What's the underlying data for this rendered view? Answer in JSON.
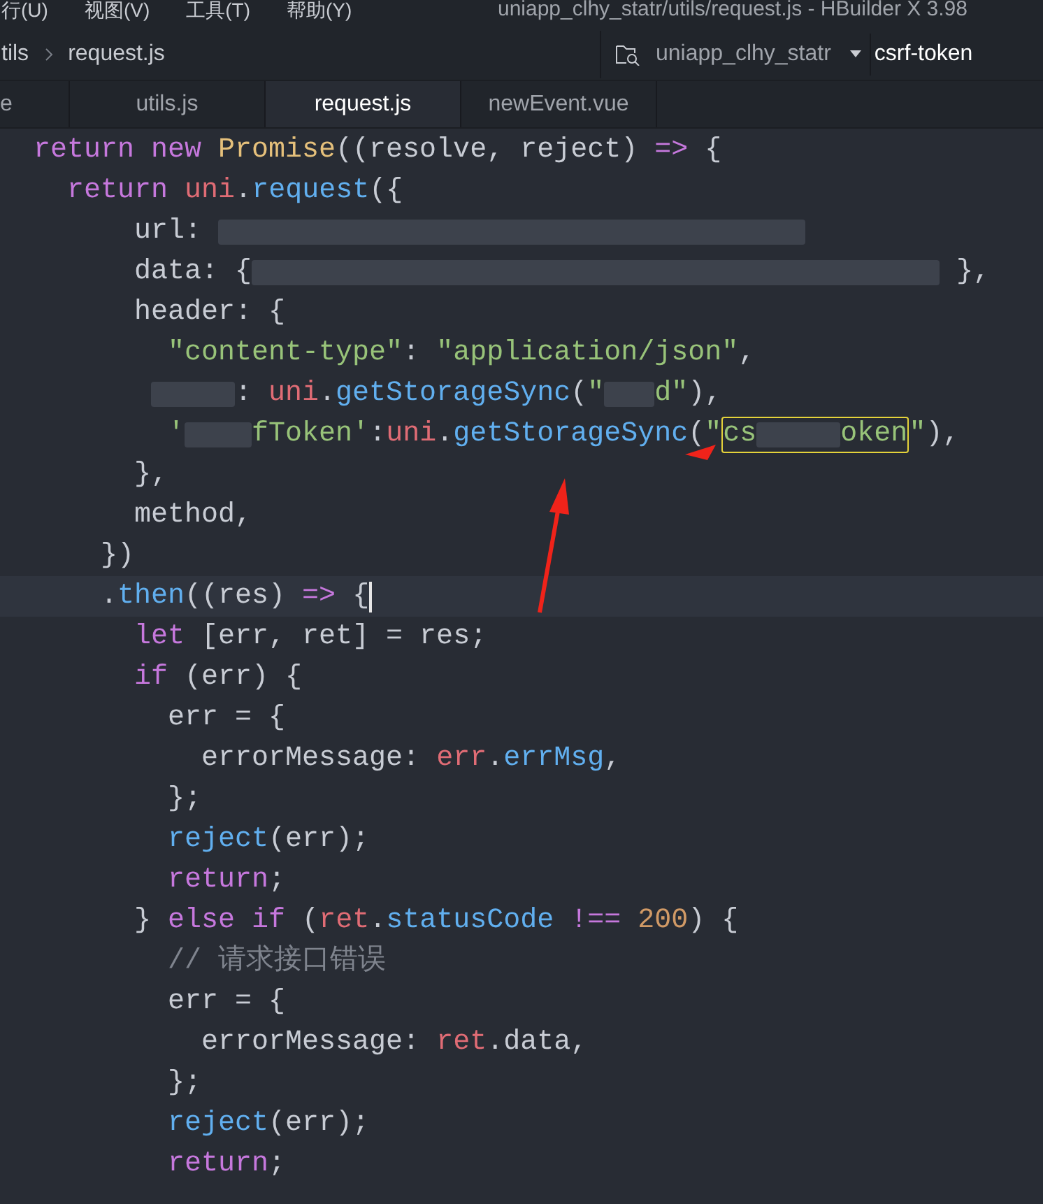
{
  "menu": [
    "行(U)",
    "视图(V)",
    "工具(T)",
    "帮助(Y)"
  ],
  "window": {
    "title": "uniapp_clhy_statr/utils/request.js - HBuilder X 3.98"
  },
  "breadcrumb": [
    "tils",
    "request.js"
  ],
  "project": {
    "name": "uniapp_clhy_statr"
  },
  "search": {
    "value": "csrf-token"
  },
  "tabs": [
    {
      "label": "e",
      "selected": false
    },
    {
      "label": "utils.js",
      "selected": false
    },
    {
      "label": "request.js",
      "selected": true
    },
    {
      "label": "newEvent.vue",
      "selected": false
    }
  ],
  "code": [
    {
      "current": false,
      "tokens": [
        {
          "kind": "kw",
          "text": "  return new "
        },
        {
          "kind": "cls",
          "text": "Promise"
        },
        {
          "kind": "plain",
          "text": "((resolve, reject) "
        },
        {
          "kind": "kw",
          "text": "=>"
        },
        {
          "kind": "plain",
          "text": " {"
        }
      ]
    },
    {
      "current": false,
      "tokens": [
        {
          "kind": "kw",
          "text": "    return "
        },
        {
          "kind": "var",
          "text": "uni"
        },
        {
          "kind": "plain",
          "text": "."
        },
        {
          "kind": "fn",
          "text": "request"
        },
        {
          "kind": "plain",
          "text": "({"
        }
      ]
    },
    {
      "current": false,
      "tokens": [
        {
          "kind": "plain",
          "text": "        url: "
        },
        {
          "kind": "blur_xl"
        }
      ]
    },
    {
      "current": false,
      "tokens": [
        {
          "kind": "plain",
          "text": "        data: {"
        },
        {
          "kind": "blur_xxl"
        },
        {
          "kind": "plain",
          "text": " },"
        }
      ]
    },
    {
      "current": false,
      "tokens": [
        {
          "kind": "plain",
          "text": "        header: {"
        }
      ]
    },
    {
      "current": false,
      "tokens": [
        {
          "kind": "str",
          "text": "          \"content-type\""
        },
        {
          "kind": "plain",
          "text": ": "
        },
        {
          "kind": "str",
          "text": "\"application/json\""
        },
        {
          "kind": "plain",
          "text": ","
        }
      ]
    },
    {
      "current": false,
      "tokens": [
        {
          "kind": "blur_key"
        },
        {
          "kind": "plain",
          "text": ": "
        },
        {
          "kind": "var",
          "text": "uni"
        },
        {
          "kind": "plain",
          "text": "."
        },
        {
          "kind": "fn",
          "text": "getStorageSync"
        },
        {
          "kind": "plain",
          "text": "("
        },
        {
          "kind": "str",
          "text": "\""
        },
        {
          "kind": "blur_s"
        },
        {
          "kind": "str",
          "text": "d\""
        },
        {
          "kind": "plain",
          "text": "),"
        }
      ]
    },
    {
      "current": false,
      "tokens": [
        {
          "kind": "str",
          "text": "          '"
        },
        {
          "kind": "blur_m"
        },
        {
          "kind": "str",
          "text": "fToken'"
        },
        {
          "kind": "plain",
          "text": ":"
        },
        {
          "kind": "var",
          "text": "uni"
        },
        {
          "kind": "plain",
          "text": "."
        },
        {
          "kind": "fn",
          "text": "getStorageSync"
        },
        {
          "kind": "plain",
          "text": "("
        },
        {
          "kind": "str",
          "text": "\""
        },
        {
          "kind": "boxed",
          "tokens": [
            {
              "kind": "str",
              "text": "cs"
            },
            {
              "kind": "blur_l"
            },
            {
              "kind": "str",
              "text": "oken"
            }
          ]
        },
        {
          "kind": "str",
          "text": "\""
        },
        {
          "kind": "plain",
          "text": "),"
        }
      ]
    },
    {
      "current": false,
      "tokens": [
        {
          "kind": "plain",
          "text": "        },"
        }
      ]
    },
    {
      "current": false,
      "tokens": [
        {
          "kind": "plain",
          "text": "        method,"
        }
      ]
    },
    {
      "current": false,
      "tokens": [
        {
          "kind": "plain",
          "text": "      })"
        }
      ]
    },
    {
      "current": true,
      "tokens": [
        {
          "kind": "plain",
          "text": "      ."
        },
        {
          "kind": "fn",
          "text": "then"
        },
        {
          "kind": "plain",
          "text": "((res) "
        },
        {
          "kind": "kw",
          "text": "=>"
        },
        {
          "kind": "plain",
          "text": " {"
        }
      ]
    },
    {
      "current": false,
      "tokens": [
        {
          "kind": "kw",
          "text": "        let"
        },
        {
          "kind": "plain",
          "text": " [err, ret] = res;"
        }
      ]
    },
    {
      "current": false,
      "tokens": [
        {
          "kind": "kw",
          "text": "        if"
        },
        {
          "kind": "plain",
          "text": " (err) {"
        }
      ]
    },
    {
      "current": false,
      "tokens": [
        {
          "kind": "plain",
          "text": "          err = {"
        }
      ]
    },
    {
      "current": false,
      "tokens": [
        {
          "kind": "plain",
          "text": "            errorMessage: "
        },
        {
          "kind": "var",
          "text": "err"
        },
        {
          "kind": "plain",
          "text": "."
        },
        {
          "kind": "fn",
          "text": "errMsg"
        },
        {
          "kind": "plain",
          "text": ","
        }
      ]
    },
    {
      "current": false,
      "tokens": [
        {
          "kind": "plain",
          "text": "          };"
        }
      ]
    },
    {
      "current": false,
      "tokens": [
        {
          "kind": "fn",
          "text": "          reject"
        },
        {
          "kind": "plain",
          "text": "(err);"
        }
      ]
    },
    {
      "current": false,
      "tokens": [
        {
          "kind": "kw",
          "text": "          return"
        },
        {
          "kind": "plain",
          "text": ";"
        }
      ]
    },
    {
      "current": false,
      "tokens": [
        {
          "kind": "plain",
          "text": "        } "
        },
        {
          "kind": "kw",
          "text": "else if"
        },
        {
          "kind": "plain",
          "text": " ("
        },
        {
          "kind": "var",
          "text": "ret"
        },
        {
          "kind": "plain",
          "text": "."
        },
        {
          "kind": "fn",
          "text": "statusCode "
        },
        {
          "kind": "kw",
          "text": "!== "
        },
        {
          "kind": "num",
          "text": "200"
        },
        {
          "kind": "plain",
          "text": ") {"
        }
      ]
    },
    {
      "current": false,
      "tokens": [
        {
          "kind": "comment",
          "text": "          // 请求接口错误"
        }
      ]
    },
    {
      "current": false,
      "tokens": [
        {
          "kind": "plain",
          "text": "          err = {"
        }
      ]
    },
    {
      "current": false,
      "tokens": [
        {
          "kind": "plain",
          "text": "            errorMessage: "
        },
        {
          "kind": "var",
          "text": "ret"
        },
        {
          "kind": "plain",
          "text": "."
        },
        {
          "kind": "plain",
          "text": "data,"
        }
      ]
    },
    {
      "current": false,
      "tokens": [
        {
          "kind": "plain",
          "text": "          };"
        }
      ]
    },
    {
      "current": false,
      "tokens": [
        {
          "kind": "fn",
          "text": "          reject"
        },
        {
          "kind": "plain",
          "text": "(err);"
        }
      ]
    },
    {
      "current": false,
      "tokens": [
        {
          "kind": "kw",
          "text": "          return"
        },
        {
          "kind": "plain",
          "text": ";"
        }
      ]
    }
  ]
}
